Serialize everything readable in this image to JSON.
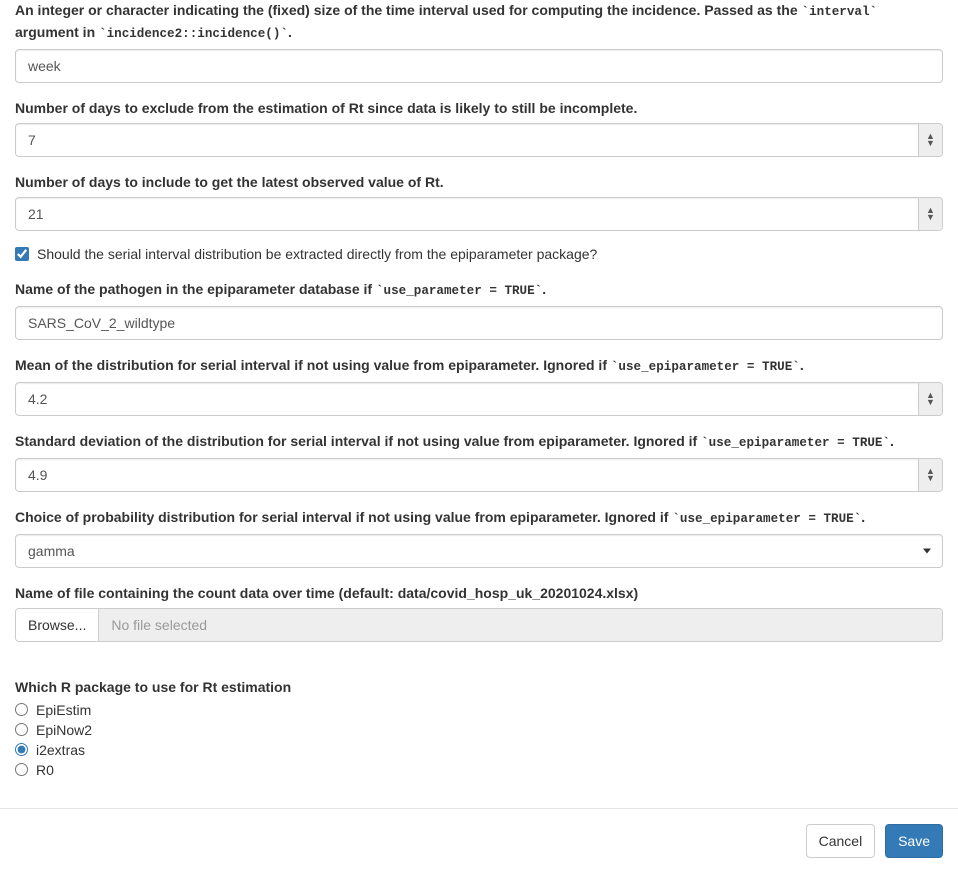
{
  "fields": {
    "interval": {
      "label_pre": "An integer or character indicating the (fixed) size of the time interval used for computing the incidence. Passed as the ",
      "label_code1": "`interval`",
      "label_mid": " argument in ",
      "label_code2": "`incidence2::incidence()`",
      "label_post": ".",
      "value": "week"
    },
    "exclude_days": {
      "label": "Number of days to exclude from the estimation of Rt since data is likely to still be incomplete.",
      "value": "7"
    },
    "include_days": {
      "label": "Number of days to include to get the latest observed value of Rt.",
      "value": "21"
    },
    "use_epiparameter": {
      "label": "Should the serial interval distribution be extracted directly from the epiparameter package?",
      "checked": true
    },
    "pathogen": {
      "label_pre": "Name of the pathogen in the epiparameter database if ",
      "label_code": "`use_parameter = TRUE`",
      "label_post": ".",
      "value": "SARS_CoV_2_wildtype"
    },
    "si_mean": {
      "label_pre": "Mean of the distribution for serial interval if not using value from epiparameter. Ignored if ",
      "label_code": "`use_epiparameter = TRUE`",
      "label_post": ".",
      "value": "4.2"
    },
    "si_sd": {
      "label_pre": "Standard deviation of the distribution for serial interval if not using value from epiparameter. Ignored if ",
      "label_code": "`use_epiparameter = TRUE`",
      "label_post": ".",
      "value": "4.9"
    },
    "si_dist": {
      "label_pre": "Choice of probability distribution for serial interval if not using value from epiparameter. Ignored if ",
      "label_code": "`use_epiparameter = TRUE`",
      "label_post": ".",
      "value": "gamma"
    },
    "data_file": {
      "label": "Name of file containing the count data over time (default: data/covid_hosp_uk_20201024.xlsx)",
      "browse_label": "Browse...",
      "placeholder": "No file selected"
    },
    "rt_package": {
      "label": "Which R package to use for Rt estimation",
      "options": [
        "EpiEstim",
        "EpiNow2",
        "i2extras",
        "R0"
      ],
      "selected": "i2extras"
    }
  },
  "footer": {
    "cancel": "Cancel",
    "save": "Save"
  }
}
